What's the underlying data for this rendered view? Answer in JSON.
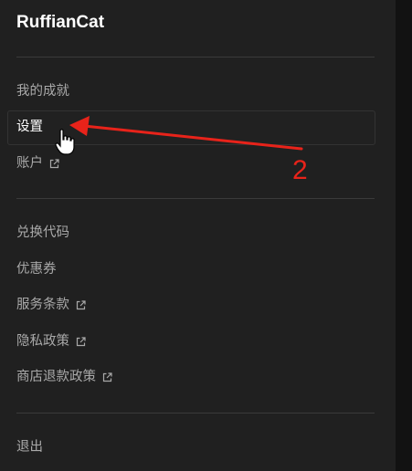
{
  "header": {
    "username": "RuffianCat"
  },
  "menu": {
    "group1": [
      {
        "label": "我的成就",
        "external": false
      },
      {
        "label": "设置",
        "external": false,
        "active": true
      },
      {
        "label": "账户",
        "external": true
      }
    ],
    "group2": [
      {
        "label": "兑换代码",
        "external": false
      },
      {
        "label": "优惠券",
        "external": false
      },
      {
        "label": "服务条款",
        "external": true
      },
      {
        "label": "隐私政策",
        "external": true
      },
      {
        "label": "商店退款政策",
        "external": true
      }
    ],
    "group3": [
      {
        "label": "退出",
        "external": false
      }
    ]
  },
  "annotation": {
    "step_number": "2",
    "color": "#e8231a"
  },
  "icons": {
    "external_link": "external-link-icon",
    "cursor": "hand-pointer-icon"
  }
}
